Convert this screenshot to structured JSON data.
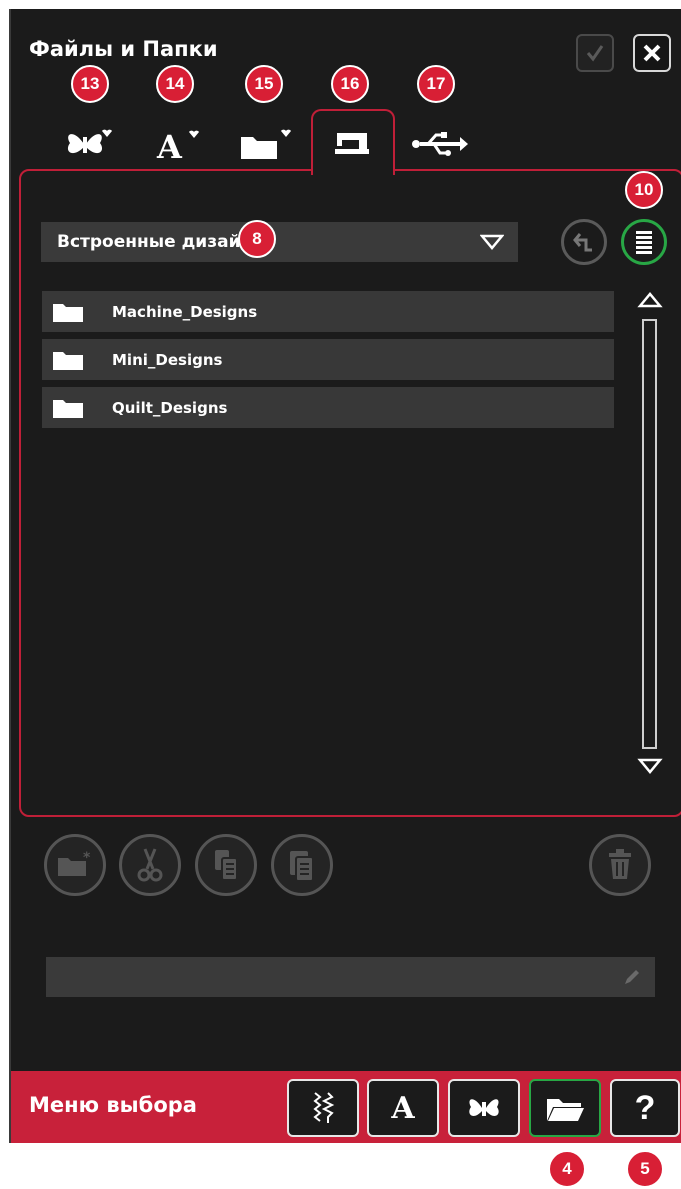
{
  "header": {
    "title": "Файлы и Папки",
    "ok_icon": "check-icon",
    "close_icon": "close-icon"
  },
  "tabs": [
    {
      "icon": "favorite-designs-icon",
      "callout": "13"
    },
    {
      "icon": "favorite-fonts-icon",
      "callout": "14"
    },
    {
      "icon": "favorite-folder-icon",
      "callout": "15"
    },
    {
      "icon": "built-in-memory-icon",
      "callout": "16",
      "active": true
    },
    {
      "icon": "usb-icon",
      "callout": "17"
    }
  ],
  "location": {
    "selected": "Встроенные дизайны",
    "callout": "8"
  },
  "list_view_callout": "10",
  "files": [
    {
      "name": "Machine_Designs",
      "type": "folder"
    },
    {
      "name": "Mini_Designs",
      "type": "folder"
    },
    {
      "name": "Quilt_Designs",
      "type": "folder"
    }
  ],
  "tools": [
    "new-folder-icon",
    "cut-icon",
    "copy-icon",
    "paste-icon",
    "delete-icon"
  ],
  "rename_field": {
    "value": "",
    "icon": "pencil-icon"
  },
  "bottom_bar": {
    "label": "Меню выбора",
    "buttons": [
      {
        "icon": "stitch-menu-icon"
      },
      {
        "icon": "font-menu-icon",
        "text": "A"
      },
      {
        "icon": "design-menu-icon"
      },
      {
        "icon": "file-manager-icon",
        "active": true,
        "callout": "4"
      },
      {
        "icon": "help-icon",
        "text": "?",
        "callout": "5"
      }
    ]
  },
  "colors": {
    "accent_red": "#c8213a",
    "active_green": "#28a745",
    "background": "#1b1b1b",
    "row": "#383838"
  }
}
